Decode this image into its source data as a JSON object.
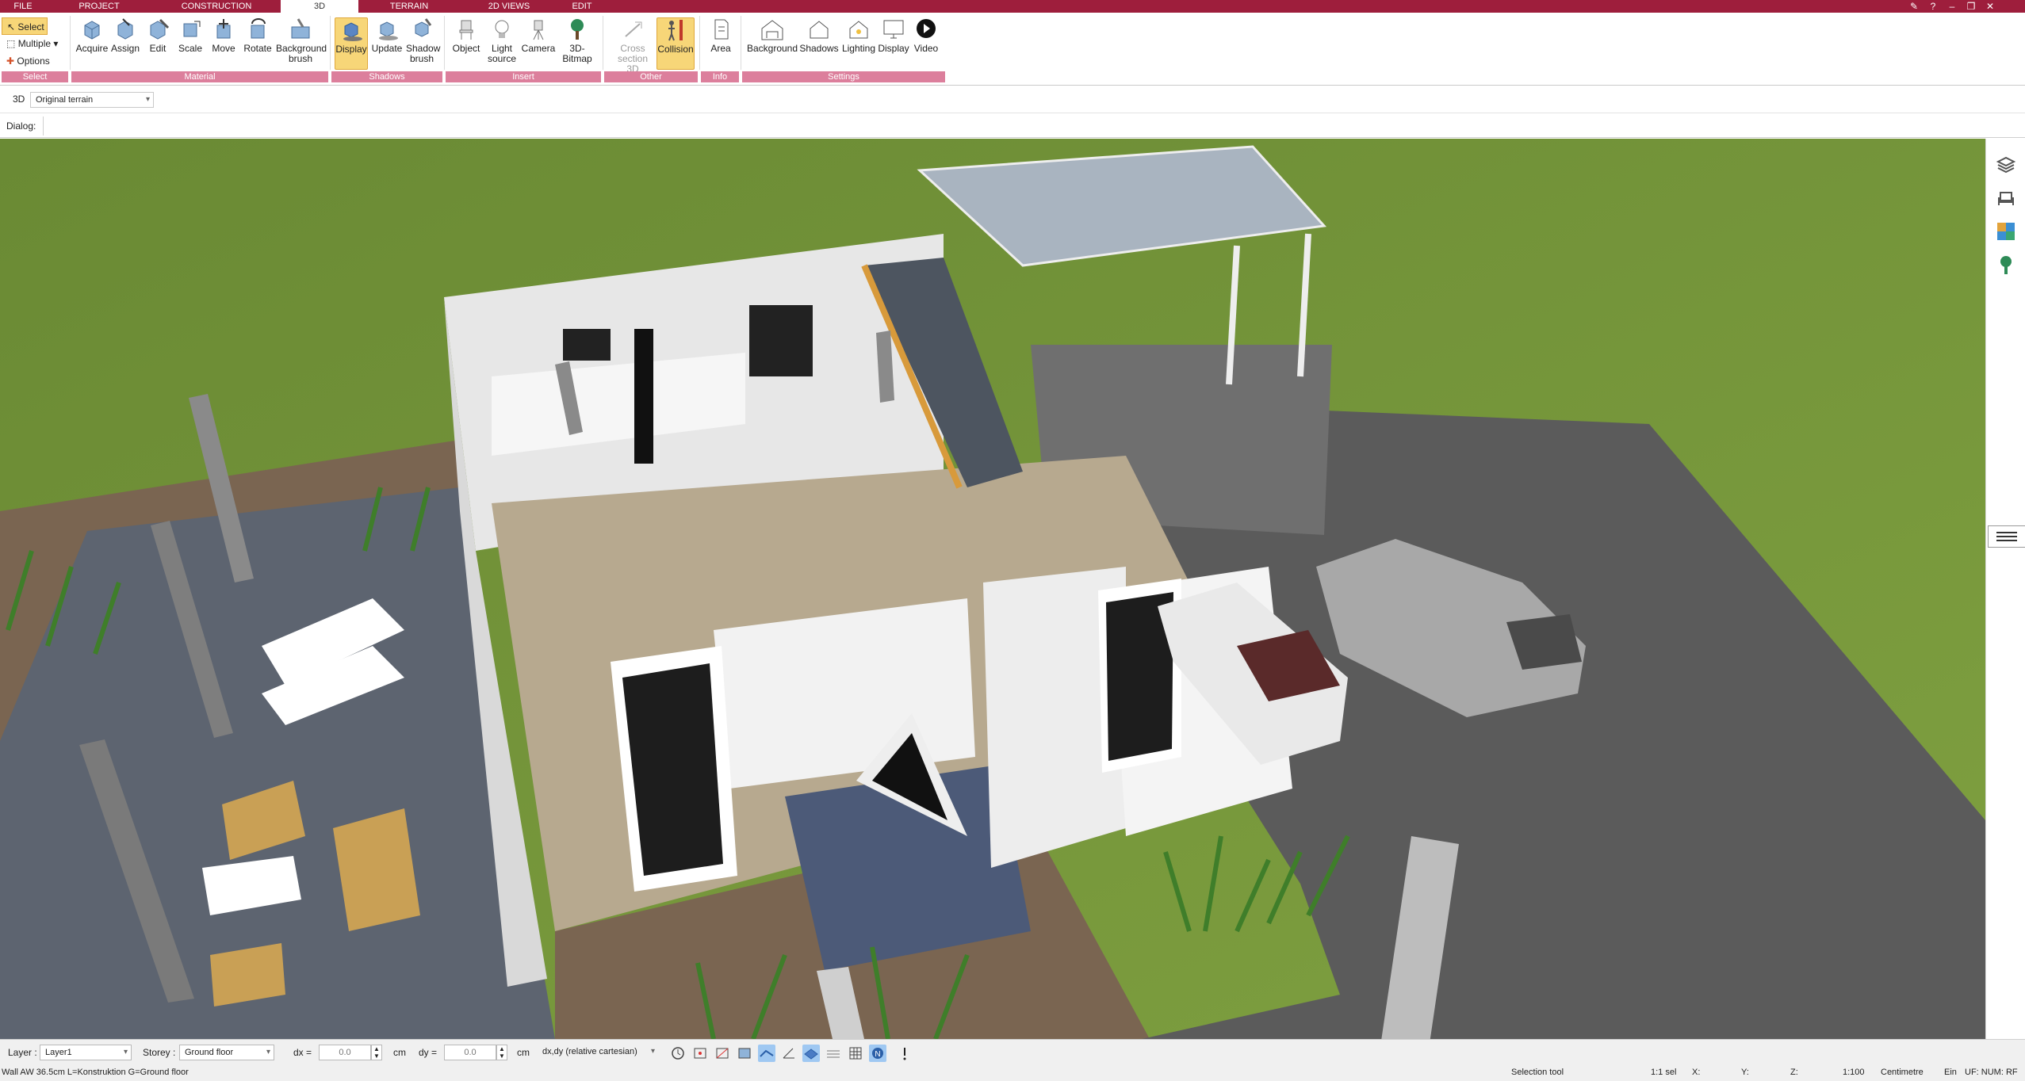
{
  "menu": {
    "tabs": [
      "FILE",
      "PROJECT",
      "CONSTRUCTION",
      "3D",
      "TERRAIN",
      "2D VIEWS",
      "EDIT"
    ],
    "active_tab": "3D"
  },
  "ribbon": {
    "select_group": {
      "select": "Select",
      "multiple": "Multiple",
      "options": "Options",
      "label": "Select"
    },
    "material": {
      "buttons": [
        "Acquire",
        "Assign",
        "Edit",
        "Scale",
        "Move",
        "Rotate",
        "Background brush"
      ],
      "label": "Material"
    },
    "shadows": {
      "buttons": [
        "Display",
        "Update",
        "Shadow brush"
      ],
      "label": "Shadows"
    },
    "insert": {
      "buttons": [
        "Object",
        "Light source",
        "Camera",
        "3D-Bitmap"
      ],
      "label": "Insert"
    },
    "other": {
      "buttons": [
        "Cross section 3D",
        "Collision"
      ],
      "label": "Other"
    },
    "info": {
      "buttons": [
        "Area"
      ],
      "label": "Info"
    },
    "settings": {
      "buttons": [
        "Background",
        "Shadows",
        "Lighting",
        "Display",
        "Video"
      ],
      "label": "Settings"
    },
    "colors": {
      "brand": "#9e1e3c",
      "group_band": "#dc7f9c",
      "highlight": "#f7d678"
    }
  },
  "view_row": {
    "mode": "3D",
    "terrain_select": "Original terrain"
  },
  "dialog_row": {
    "label": "Dialog:"
  },
  "status": {
    "layer_label": "Layer :",
    "layer_value": "Layer1",
    "storey_label": "Storey :",
    "storey_value": "Ground floor",
    "dx_label": "dx =",
    "dx_value": "0.0",
    "dx_unit": "cm",
    "dy_label": "dy =",
    "dy_value": "0.0",
    "dy_unit": "cm",
    "coord_mode": "dx,dy (relative cartesian)"
  },
  "status_line": {
    "info": "Wall AW 36.5cm L=Konstruktion G=Ground floor",
    "tool": "Selection tool",
    "selection": "1:1 sel",
    "x": "X:",
    "y": "Y:",
    "z": "Z:",
    "scale": "1:100",
    "unit": "Centimetre",
    "ein": "Ein",
    "uf_num": "UF: NUM: RF"
  }
}
